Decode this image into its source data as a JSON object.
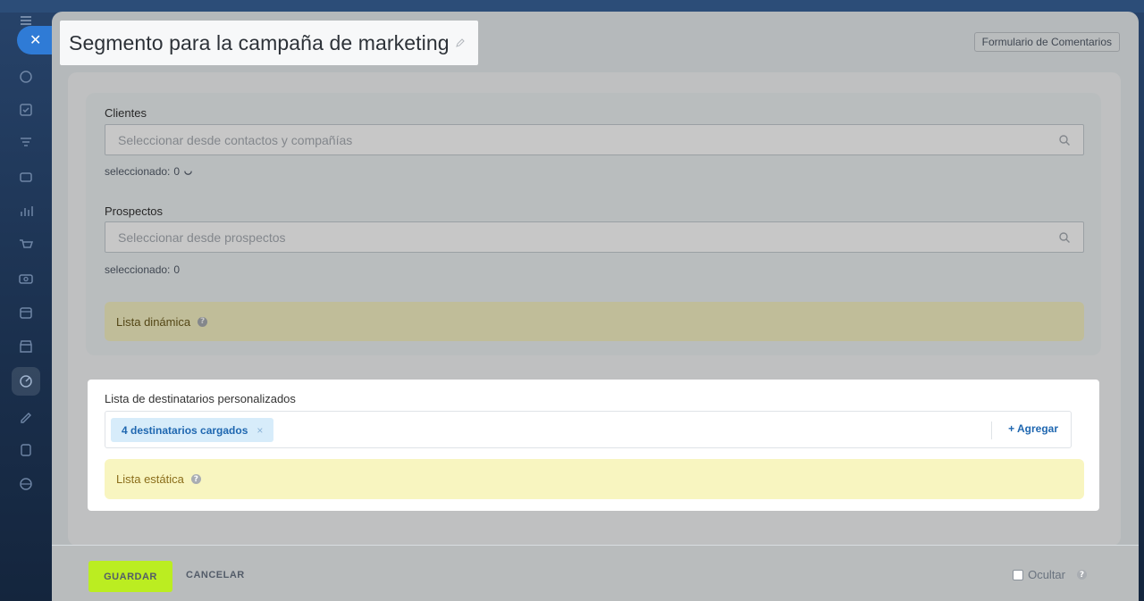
{
  "panel": {
    "title": "Segmento para la campaña de marketing",
    "feedback_button": "Formulario de Comentarios"
  },
  "clients": {
    "label": "Clientes",
    "placeholder": "Seleccionar desde contactos y compañías",
    "selected_label": "seleccionado:",
    "selected_count": "0"
  },
  "leads": {
    "label": "Prospectos",
    "placeholder": "Seleccionar desde prospectos",
    "selected_label": "seleccionado:",
    "selected_count": "0"
  },
  "dynamic_list": {
    "label": "Lista dinámica"
  },
  "custom_recipients": {
    "label": "Lista de destinatarios personalizados",
    "tag": "4 destinatarios cargados",
    "tag_remove": "×",
    "add_button": "+ Agregar"
  },
  "static_list": {
    "label": "Lista estática"
  },
  "footer": {
    "save": "GUARDAR",
    "cancel": "CANCELAR",
    "hide": "Ocultar"
  },
  "icons": {
    "close": "close-icon",
    "pencil": "pencil-icon",
    "search": "search-icon",
    "help": "help-icon"
  },
  "colors": {
    "save_button": "#bbed21",
    "accent_blue": "#1f67b0",
    "yellow_bar": "#f8f5c0"
  }
}
